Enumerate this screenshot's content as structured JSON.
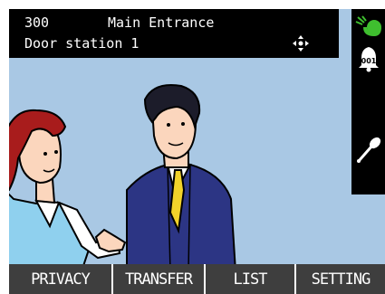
{
  "info": {
    "number": "300",
    "location": "Main Entrance",
    "station": "Door station 1"
  },
  "side_icons": [
    "call-answered-icon",
    "bell-icon",
    "microphone-icon"
  ],
  "bell_badge": "001",
  "soft_keys": [
    "PRIVACY",
    "TRANSFER",
    "LIST",
    "SETTING"
  ],
  "colors": {
    "background": "#a9c8e4",
    "panel": "#000000",
    "soft_key": "#3e3e3e",
    "status_green": "#3fbf2f"
  }
}
